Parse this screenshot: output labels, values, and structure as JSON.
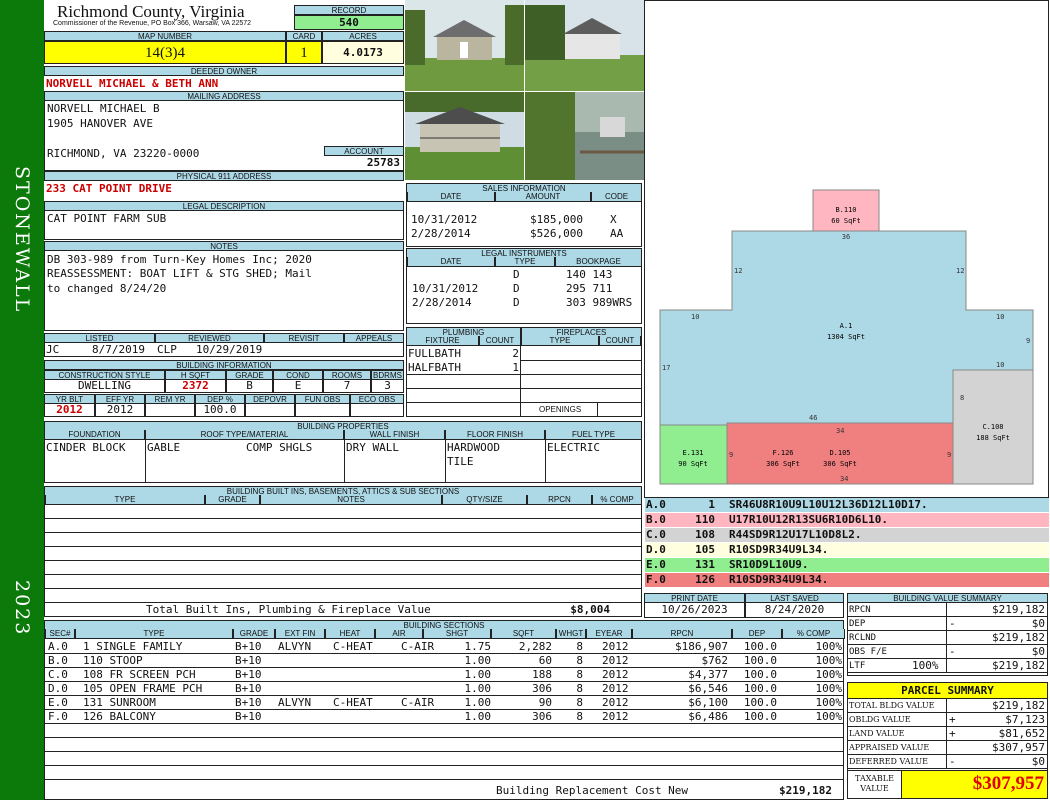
{
  "county": "Richmond County, Virginia",
  "commissioner": "Commissioner of the Revenue, PO Box 366, Warsaw, VA 22572",
  "sidebar": {
    "district": "STONEWALL",
    "year": "2023"
  },
  "record": {
    "label": "RECORD",
    "value": "540"
  },
  "map": {
    "label": "MAP NUMBER",
    "value": "14(3)4"
  },
  "card": {
    "label": "CARD",
    "value": "1"
  },
  "acres": {
    "label": "ACRES",
    "value": "4.0173"
  },
  "owner": {
    "label": "DEEDED OWNER",
    "value": "NORVELL MICHAEL & BETH ANN"
  },
  "mailing": {
    "label": "MAILING ADDRESS",
    "line1": "NORVELL MICHAEL B",
    "line2": "1905 HANOVER AVE",
    "line3": "RICHMOND, VA 23220-0000"
  },
  "account": {
    "label": "ACCOUNT",
    "value": "25783"
  },
  "physical": {
    "label": "PHYSICAL 911 ADDRESS",
    "value": "233 CAT POINT DRIVE"
  },
  "legal": {
    "label": "LEGAL DESCRIPTION",
    "value": "CAT POINT FARM SUB"
  },
  "notes": {
    "label": "NOTES",
    "line1": "DB 303-989 from Turn-Key Homes Inc; 2020",
    "line2": "REASSESSMENT: BOAT LIFT & STG SHED; Mail",
    "line3": "to changed 8/24/20"
  },
  "listed": {
    "label": "LISTED",
    "by": "JC",
    "date": "8/7/2019"
  },
  "reviewed": {
    "label": "REVIEWED",
    "by": "CLP",
    "date": "10/29/2019"
  },
  "revisit": {
    "label": "REVISIT"
  },
  "appeals": {
    "label": "APPEALS"
  },
  "building_info": {
    "label": "BUILDING INFORMATION",
    "h": [
      "CONSTRUCTION STYLE",
      "H SQFT",
      "GRADE",
      "COND",
      "ROOMS",
      "BDRMS"
    ],
    "v": [
      "DWELLING",
      "2372",
      "B",
      "E",
      "7",
      "3"
    ],
    "h2": [
      "YR BLT",
      "EFF YR",
      "REM YR",
      "DEP %",
      "DEPOVR",
      "FUN OBS",
      "ECO OBS"
    ],
    "v2": [
      "2012",
      "2012",
      "",
      "100.0",
      "",
      "",
      ""
    ]
  },
  "sales": {
    "label": "SALES INFORMATION",
    "h": [
      "DATE",
      "AMOUNT",
      "CODE"
    ],
    "rows": [
      [
        "10/31/2012",
        "$185,000",
        "X"
      ],
      [
        "2/28/2014",
        "$526,000",
        "AA"
      ]
    ]
  },
  "legal_instr": {
    "label": "LEGAL INSTRUMENTS",
    "h": [
      "DATE",
      "TYPE",
      "BOOKPAGE"
    ],
    "rows": [
      [
        "",
        "D",
        "140 143"
      ],
      [
        "10/31/2012",
        "D",
        "295 711"
      ],
      [
        "2/28/2014",
        "D",
        "303 989WRS"
      ]
    ]
  },
  "plumbing": {
    "label": "PLUMBING",
    "h": [
      "FIXTURE",
      "COUNT"
    ],
    "rows": [
      [
        "FULLBATH",
        "2"
      ],
      [
        "HALFBATH",
        "1"
      ]
    ]
  },
  "fireplaces": {
    "label": "FIREPLACES",
    "h": [
      "TYPE",
      "COUNT"
    ],
    "openings": "OPENINGS"
  },
  "props": {
    "label": "BUILDING PROPERTIES",
    "h": [
      "FOUNDATION",
      "ROOF TYPE/MATERIAL",
      "WALL FINISH",
      "FLOOR FINISH",
      "FUEL TYPE"
    ],
    "foundation": "CINDER BLOCK",
    "roof_type": "GABLE",
    "roof_mat": "COMP SHGLS",
    "wall": "DRY WALL",
    "floor1": "HARDWOOD",
    "floor2": "TILE",
    "fuel": "ELECTRIC"
  },
  "builtins": {
    "label": "BUILDING BUILT INS, BASEMENTS, ATTICS & SUB SECTIONS",
    "h": [
      "TYPE",
      "GRADE",
      "NOTES",
      "QTY/SIZE",
      "RPCN",
      "% COMP"
    ],
    "total_label": "Total Built Ins, Plumbing & Fireplace Value",
    "total": "$8,004"
  },
  "sections": {
    "label": "BUILDING SECTIONS",
    "h": [
      "SEC#",
      "TYPE",
      "GRADE",
      "EXT FIN",
      "HEAT",
      "AIR",
      "SHGT",
      "SQFT",
      "WHGT",
      "EYEAR",
      "RPCN",
      "DEP",
      "% COMP"
    ],
    "rows": [
      [
        "A.0",
        "1 SINGLE FAMILY",
        "B+10",
        "ALVYN",
        "C-HEAT",
        "C-AIR",
        "1.75",
        "2,282",
        "8",
        "2012",
        "$186,907",
        "100.0",
        "100%"
      ],
      [
        "B.0",
        "110 STOOP",
        "B+10",
        "",
        "",
        "",
        "1.00",
        "60",
        "8",
        "2012",
        "$762",
        "100.0",
        "100%"
      ],
      [
        "C.0",
        "108 FR SCREEN PCH",
        "B+10",
        "",
        "",
        "",
        "1.00",
        "188",
        "8",
        "2012",
        "$4,377",
        "100.0",
        "100%"
      ],
      [
        "D.0",
        "105 OPEN FRAME PCH",
        "B+10",
        "",
        "",
        "",
        "1.00",
        "306",
        "8",
        "2012",
        "$6,546",
        "100.0",
        "100%"
      ],
      [
        "E.0",
        "131 SUNROOM",
        "B+10",
        "ALVYN",
        "C-HEAT",
        "C-AIR",
        "1.00",
        "90",
        "8",
        "2012",
        "$6,100",
        "100.0",
        "100%"
      ],
      [
        "F.0",
        "126 BALCONY",
        "B+10",
        "",
        "",
        "",
        "1.00",
        "306",
        "8",
        "2012",
        "$6,486",
        "100.0",
        "100%"
      ]
    ],
    "brcn_label": "Building Replacement Cost New",
    "brcn": "$219,182"
  },
  "sketch": {
    "B": {
      "id": "B.110",
      "area": "60 SqFt",
      "color": "#ffb6c1"
    },
    "A": {
      "id": "A.1",
      "area": "1304 SqFt",
      "color": "#add8e6"
    },
    "C": {
      "id": "C.108",
      "area": "188 SqFt",
      "color": "#d3d3d3"
    },
    "E": {
      "id": "E.131",
      "area": "90 SqFt",
      "color": "#90ee90"
    },
    "F": {
      "id": "F.126",
      "area": "306 SqFt",
      "color": "#f08080"
    },
    "D": {
      "id": "D.105",
      "area": "306 SqFt",
      "color": "#f08080"
    },
    "dims": [
      "36",
      "12",
      "12",
      "10",
      "10",
      "9",
      "10",
      "17",
      "8",
      "46",
      "34",
      "9",
      "9",
      "34"
    ]
  },
  "legend": [
    {
      "sec": "A.0",
      "code": "1",
      "vec": "SR46U8R10U9L10U12L36D12L10D17.",
      "color": "#add8e6"
    },
    {
      "sec": "B.0",
      "code": "110",
      "vec": "U17R10U12R13SU6R10D6L10.",
      "color": "#ffb6c1"
    },
    {
      "sec": "C.0",
      "code": "108",
      "vec": "R44SD9R12U17L10D8L2.",
      "color": "#d3d3d3"
    },
    {
      "sec": "D.0",
      "code": "105",
      "vec": "R10SD9R34U9L34.",
      "color": "#ffffe0"
    },
    {
      "sec": "E.0",
      "code": "131",
      "vec": "SR10D9L10U9.",
      "color": "#90ee90"
    },
    {
      "sec": "F.0",
      "code": "126",
      "vec": "R10SD9R34U9L34.",
      "color": "#f08080"
    }
  ],
  "print": {
    "label": "PRINT DATE",
    "value": "10/26/2023"
  },
  "saved": {
    "label": "LAST SAVED",
    "value": "8/24/2020"
  },
  "bvs": {
    "label": "BUILDING VALUE SUMMARY",
    "rows": [
      [
        "RPCN",
        "",
        "$219,182"
      ],
      [
        "DEP",
        "-",
        "$0"
      ],
      [
        "RCLND",
        "",
        "$219,182"
      ],
      [
        "OBS F/E",
        "-",
        "$0"
      ],
      [
        "LTF",
        "100%",
        "$219,182"
      ]
    ]
  },
  "parcel": {
    "label": "PARCEL SUMMARY",
    "rows": [
      [
        "TOTAL BLDG VALUE",
        "",
        "$219,182"
      ],
      [
        "OBLDG VALUE",
        "+",
        "$7,123"
      ],
      [
        "LAND VALUE",
        "+",
        "$81,652"
      ],
      [
        "APPRAISED VALUE",
        "",
        "$307,957"
      ],
      [
        "DEFERRED VALUE",
        "-",
        "$0"
      ]
    ],
    "taxable_label1": "TAXABLE",
    "taxable_label2": "VALUE",
    "taxable": "$307,957"
  }
}
